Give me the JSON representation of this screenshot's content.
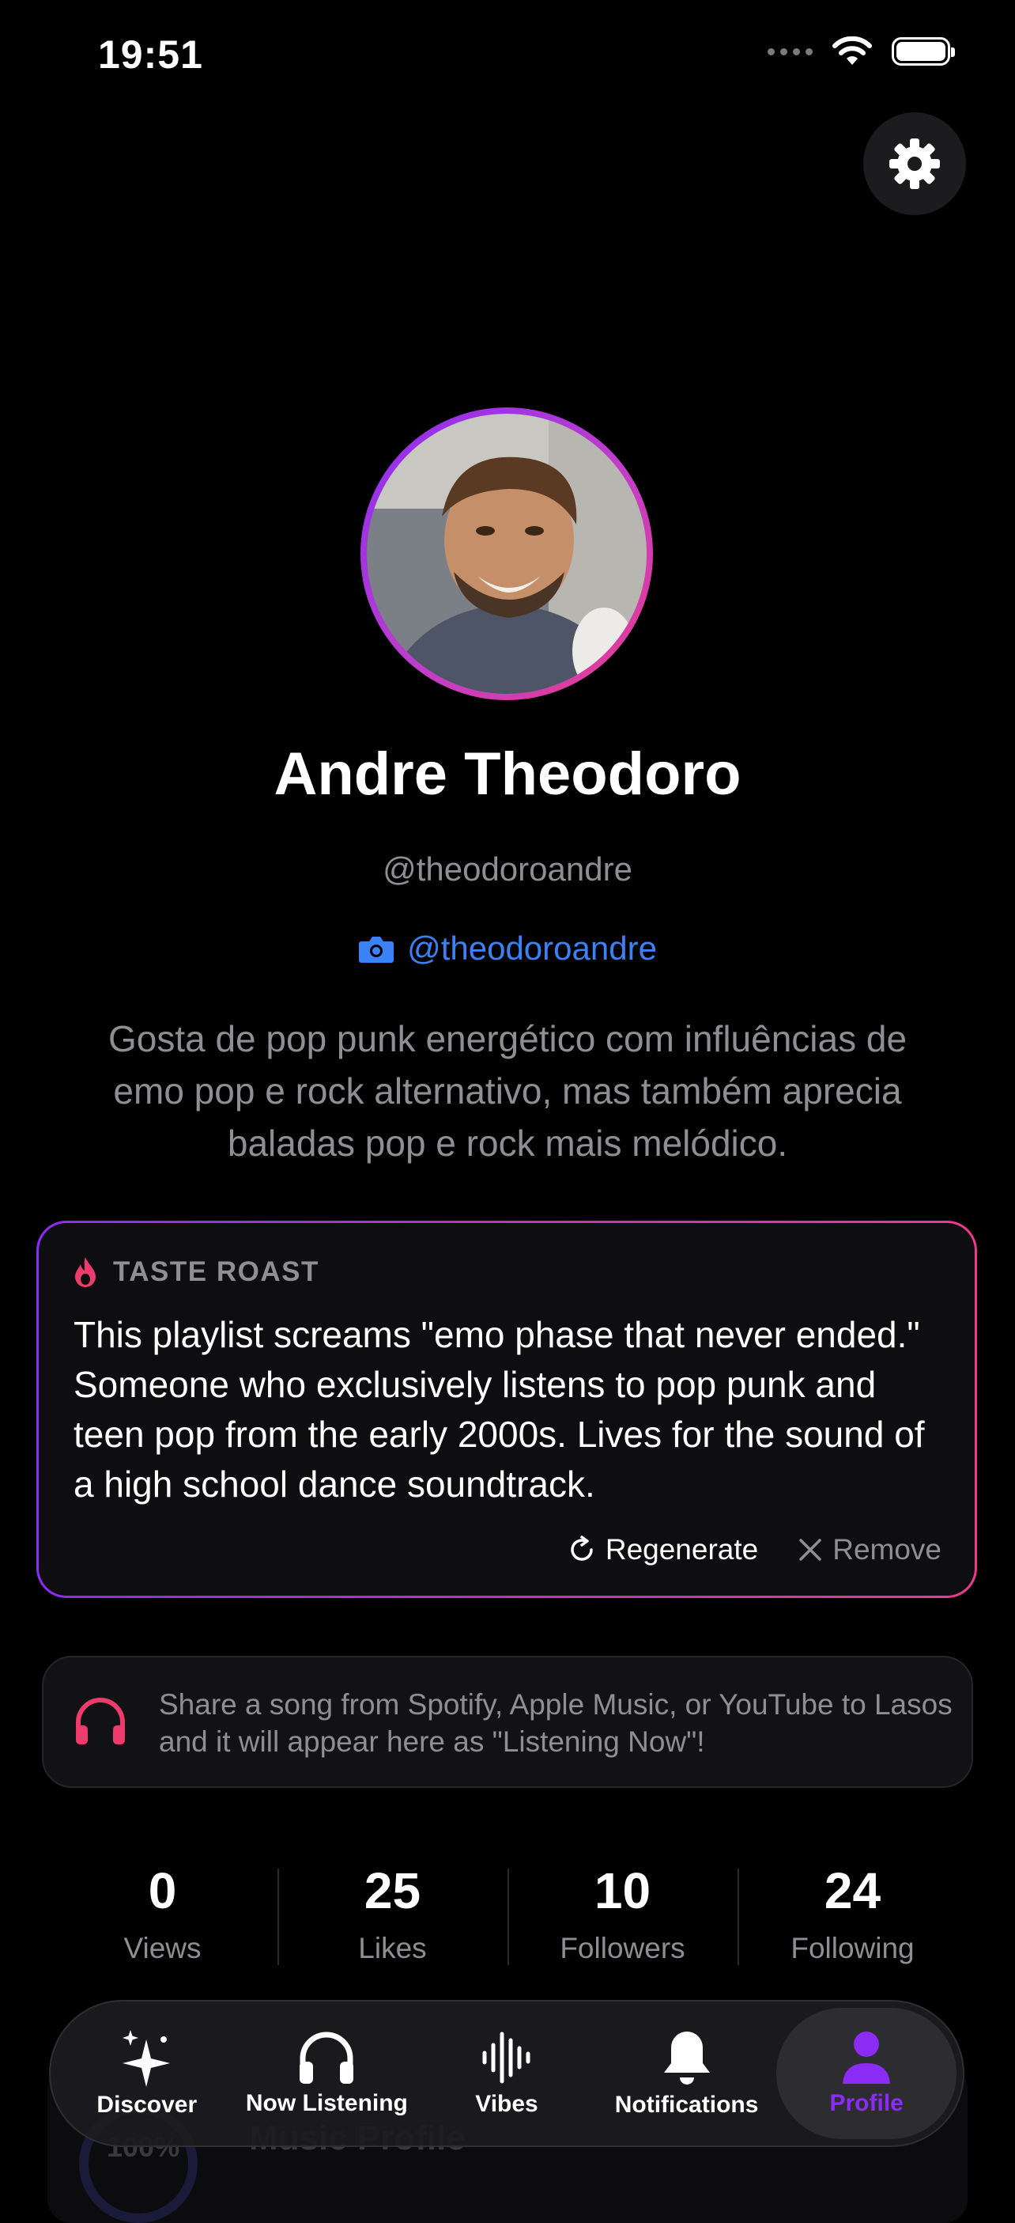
{
  "status_bar": {
    "time": "19:51"
  },
  "profile": {
    "name": "Andre Theodoro",
    "handle": "@theodoroandre",
    "instagram": "@theodoroandre",
    "bio": "Gosta de pop punk energético com influências de emo pop e rock alternativo, mas também aprecia baladas pop e rock mais melódico."
  },
  "roast": {
    "title": "TASTE ROAST",
    "text": "This playlist screams \"emo phase that never ended.\" Someone who exclusively listens to pop punk and teen pop from the early 2000s. Lives for the sound of a high school dance soundtrack.",
    "regenerate_label": "Regenerate",
    "remove_label": "Remove"
  },
  "share_hint": "Share a song from Spotify, Apple Music, or YouTube to Lasos and it will appear here as \"Listening Now\"!",
  "stats": [
    {
      "value": "0",
      "label": "Views"
    },
    {
      "value": "25",
      "label": "Likes"
    },
    {
      "value": "10",
      "label": "Followers"
    },
    {
      "value": "24",
      "label": "Following"
    }
  ],
  "music_profile": {
    "label": "Music Profile",
    "percent": "100%"
  },
  "tabs": [
    {
      "label": "Discover",
      "icon": "sparkles-icon"
    },
    {
      "label": "Now Listening",
      "icon": "headphones-icon"
    },
    {
      "label": "Vibes",
      "icon": "waveform-icon"
    },
    {
      "label": "Notifications",
      "icon": "bell-icon"
    },
    {
      "label": "Profile",
      "icon": "person-icon",
      "active": true
    }
  ],
  "colors": {
    "accent": "#8b2cf5",
    "pink": "#ec3b8c",
    "link": "#3b82f6",
    "muted": "#8e8e93"
  }
}
